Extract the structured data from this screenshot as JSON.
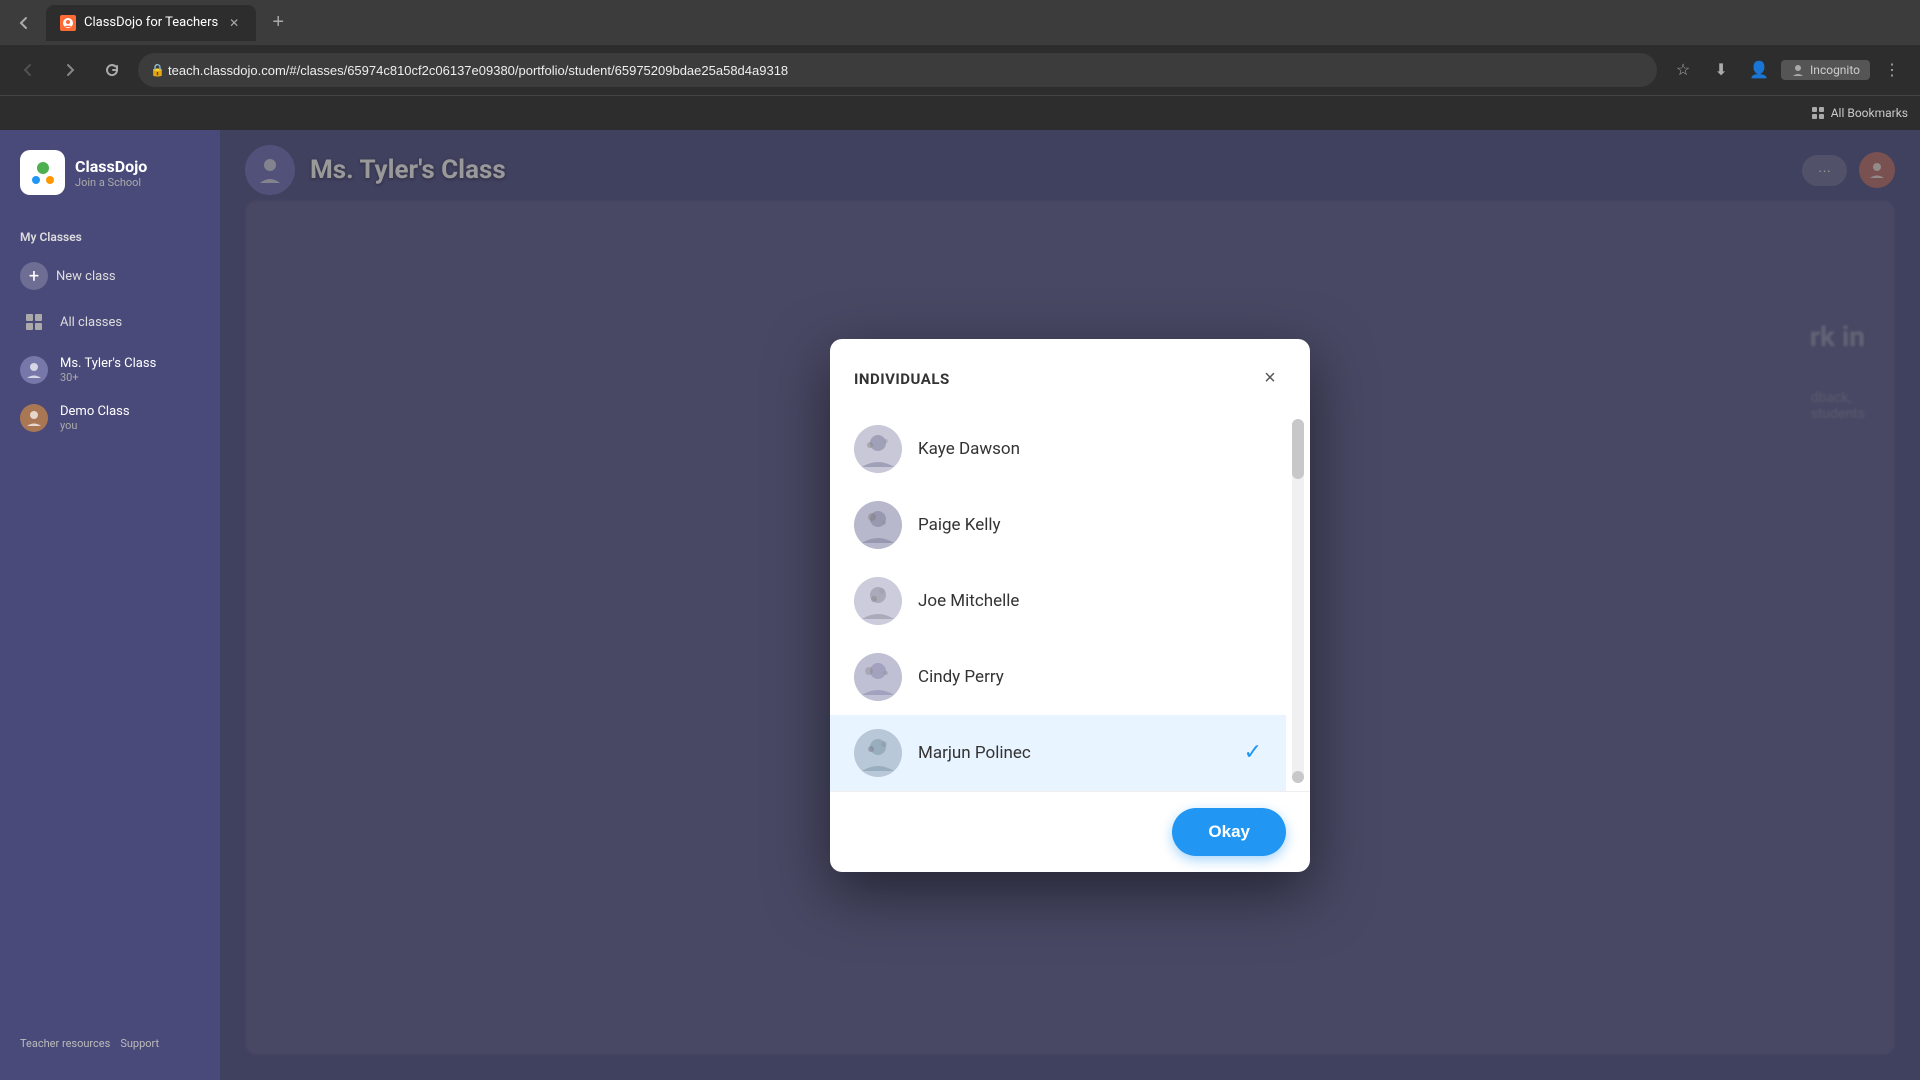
{
  "browser": {
    "tab_title": "ClassDojo for Teachers",
    "url": "teach.classdojo.com/#/classes/65974c810cf2c06137e09380/portfolio/student/65975209bdae25a58d4a9318",
    "incognito_label": "Incognito",
    "bookmarks_label": "All Bookmarks"
  },
  "sidebar": {
    "logo_text": "ClassDojo",
    "logo_sub": "Join a School",
    "my_classes_label": "My Classes",
    "new_class_label": "New class",
    "all_classes_label": "All classes",
    "class1_label": "Ms. Tyler's Class",
    "class1_sub": "30+",
    "class2_label": "Demo Class",
    "class2_sub": "you",
    "teacher_resources_label": "Teacher resources",
    "support_label": "Support"
  },
  "header": {
    "class_title": "Ms. Tyler's Class"
  },
  "modal": {
    "title": "INDIVIDUALS",
    "close_label": "×",
    "ok_label": "Okay",
    "students": [
      {
        "id": 1,
        "name": "Kaye Dawson",
        "selected": false
      },
      {
        "id": 2,
        "name": "Paige Kelly",
        "selected": false
      },
      {
        "id": 3,
        "name": "Joe Mitchelle",
        "selected": false
      },
      {
        "id": 4,
        "name": "Cindy Perry",
        "selected": false
      },
      {
        "id": 5,
        "name": "Marjun Polinec",
        "selected": true
      }
    ]
  },
  "background_card": {
    "text": "rk in"
  }
}
